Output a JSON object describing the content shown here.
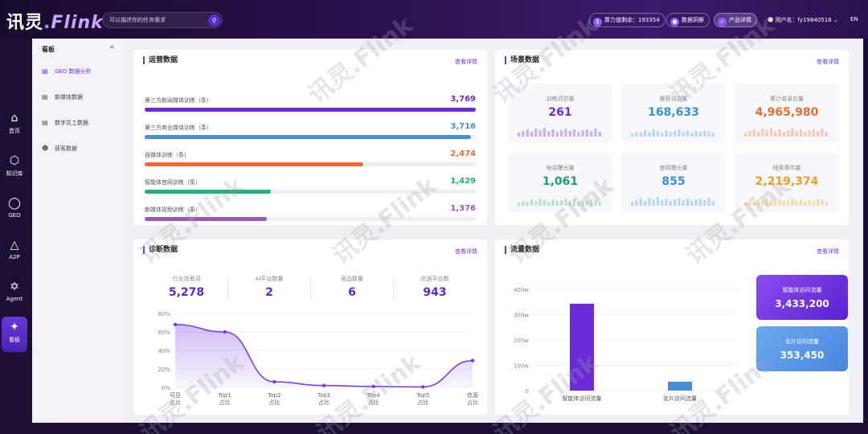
{
  "app": {
    "logo_main": "讯灵",
    "logo_dot": ".",
    "logo_sub": "Flink"
  },
  "search": {
    "placeholder": "可以描述你的任务需求"
  },
  "header": {
    "balance": "算力值剩余：193354",
    "data_cockpit": "数据洞察",
    "product_detail": "产品详情",
    "user": "用户名：fy19840516",
    "lang": "EN"
  },
  "leftnav": [
    {
      "label": "首页",
      "icon": "home-icon"
    },
    {
      "label": "知识库",
      "icon": "knowledge-icon"
    },
    {
      "label": "GEO",
      "icon": "geo-icon"
    },
    {
      "label": "A2P",
      "icon": "a2p-icon"
    },
    {
      "label": "Agent",
      "icon": "agent-icon"
    },
    {
      "label": "看板",
      "icon": "dashboard-icon"
    }
  ],
  "sidebar": {
    "title": "看板",
    "items": [
      {
        "label": "GEO 数据分析"
      },
      {
        "label": "新媒体数据"
      },
      {
        "label": "数字员工数据"
      },
      {
        "label": "获客数据"
      }
    ]
  },
  "ops": {
    "title": "运营数据",
    "more": "查看详情",
    "rows": [
      {
        "label": "第三方新闻媒体训练（条）",
        "value": "3,769",
        "fraction": 1.0,
        "color": "#6a2ad8"
      },
      {
        "label": "第三方商业媒体训练（条）",
        "value": "3,716",
        "fraction": 0.985,
        "color": "#4a8fd6"
      },
      {
        "label": "自媒体训练（条）",
        "value": "2,474",
        "fraction": 0.66,
        "color": "#ee6a30"
      },
      {
        "label": "智能体官网训练（条）",
        "value": "1,429",
        "fraction": 0.38,
        "color": "#1fb27a"
      },
      {
        "label": "新媒体视频训练（条）",
        "value": "1,376",
        "fraction": 0.37,
        "color": "#9b59b6"
      }
    ]
  },
  "scene": {
    "title": "场景数据",
    "more": "查看详情",
    "cards": [
      {
        "label": "训练词总量",
        "value": "261",
        "color": "#6a2ad8",
        "bar_color": "#c7b2f0"
      },
      {
        "label": "推荐词总量",
        "value": "168,633",
        "color": "#3a8fd8",
        "bar_color": "#b7d6f3"
      },
      {
        "label": "累计收录总量",
        "value": "4,965,980",
        "color": "#ee6a30",
        "bar_color": "#f7c9b2"
      },
      {
        "label": "电话曝光量",
        "value": "1,061",
        "color": "#1fa06a",
        "bar_color": "#b6e3cd"
      },
      {
        "label": "官网曝光量",
        "value": "855",
        "color": "#3a8fd8",
        "bar_color": "#b7d6f3"
      },
      {
        "label": "线索事件量",
        "value": "2,219,374",
        "color": "#e8a020",
        "bar_color": "#f6dba5"
      }
    ]
  },
  "diag": {
    "title": "诊断数据",
    "more": "查看详情",
    "stats": [
      {
        "label": "行业场景词",
        "value": "5,278"
      },
      {
        "label": "AI平台数量",
        "value": "2"
      },
      {
        "label": "竞品数量",
        "value": "6"
      },
      {
        "label": "信源平台数",
        "value": "943"
      }
    ]
  },
  "flow": {
    "title": "流量数据",
    "more": "查看详情",
    "cards": [
      {
        "label": "智能体访问流量",
        "value": "3,433,200"
      },
      {
        "label": "名片访问流量",
        "value": "353,450"
      }
    ]
  },
  "chart_data": [
    {
      "type": "area",
      "y_unit": "%",
      "ylim": [
        0,
        80
      ],
      "y_ticks": [
        "80%",
        "60%",
        "40%",
        "20%",
        "0%"
      ],
      "categories": [
        [
          "可见",
          "占比"
        ],
        [
          "Top1",
          "占比"
        ],
        [
          "Top2",
          "占比"
        ],
        [
          "Top3",
          "占比"
        ],
        [
          "Top4",
          "占比"
        ],
        [
          "Top5",
          "占比"
        ],
        [
          "信源",
          "占比"
        ]
      ],
      "values": [
        68,
        60,
        6,
        2,
        1,
        0.5,
        29
      ],
      "color": "#7b3fe4"
    },
    {
      "type": "bar",
      "ylim": [
        0,
        400
      ],
      "y_ticks": [
        "400w",
        "300w",
        "200w",
        "100w",
        "0"
      ],
      "categories": [
        "智能体访问流量",
        "名片访问流量"
      ],
      "values": [
        343.32,
        35.345
      ],
      "colors": [
        "#6a2ad8",
        "#4a8fd6"
      ]
    }
  ],
  "watermark": "讯灵.Flink"
}
